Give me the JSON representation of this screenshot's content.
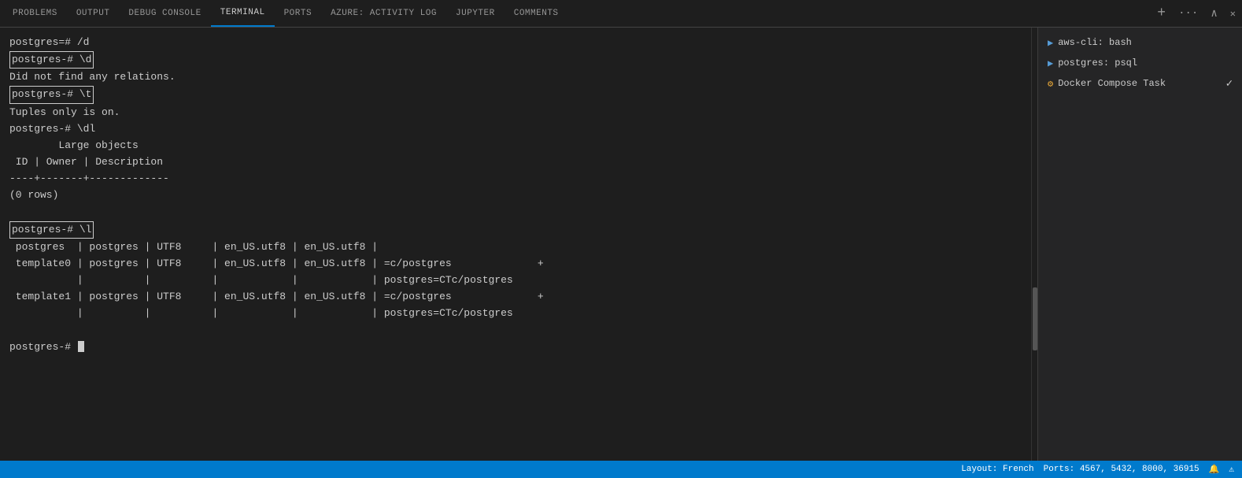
{
  "tabs": [
    {
      "id": "problems",
      "label": "PROBLEMS",
      "active": false
    },
    {
      "id": "output",
      "label": "OUTPUT",
      "active": false
    },
    {
      "id": "debug-console",
      "label": "DEBUG CONSOLE",
      "active": false
    },
    {
      "id": "terminal",
      "label": "TERMINAL",
      "active": true
    },
    {
      "id": "ports",
      "label": "PORTS",
      "active": false
    },
    {
      "id": "azure-activity-log",
      "label": "AZURE: ACTIVITY LOG",
      "active": false
    },
    {
      "id": "jupyter",
      "label": "JUPYTER",
      "active": false
    },
    {
      "id": "comments",
      "label": "COMMENTS",
      "active": false
    }
  ],
  "toolbar": {
    "add_label": "+",
    "more_label": "···",
    "chevron_up_label": "∧",
    "close_label": "✕"
  },
  "terminal": {
    "lines": [
      {
        "type": "normal",
        "text": "postgres=# /d"
      },
      {
        "type": "boxed",
        "text": "postgres-# \\d"
      },
      {
        "type": "normal",
        "text": "Did not find any relations."
      },
      {
        "type": "boxed",
        "text": "postgres-# \\t"
      },
      {
        "type": "normal",
        "text": "Tuples only is on."
      },
      {
        "type": "normal",
        "text": "postgres-# \\dl"
      },
      {
        "type": "normal",
        "text": "        Large objects"
      },
      {
        "type": "normal",
        "text": " ID | Owner | Description"
      },
      {
        "type": "normal",
        "text": "----+-------+-------------"
      },
      {
        "type": "normal",
        "text": "(0 rows)"
      },
      {
        "type": "blank",
        "text": ""
      },
      {
        "type": "boxed",
        "text": "postgres-# \\l"
      },
      {
        "type": "normal",
        "text": " postgres  | postgres | UTF8     | en_US.utf8 | en_US.utf8 |"
      },
      {
        "type": "normal",
        "text": " template0 | postgres | UTF8     | en_US.utf8 | en_US.utf8 | =c/postgres              +"
      },
      {
        "type": "normal",
        "text": "           |          |          |            |            | postgres=CTc/postgres"
      },
      {
        "type": "normal",
        "text": " template1 | postgres | UTF8     | en_US.utf8 | en_US.utf8 | =c/postgres              +"
      },
      {
        "type": "normal",
        "text": "           |          |          |            |            | postgres=CTc/postgres"
      },
      {
        "type": "blank",
        "text": ""
      },
      {
        "type": "prompt",
        "text": "postgres-# "
      }
    ]
  },
  "right_panel": {
    "items": [
      {
        "id": "aws-cli-bash",
        "label": "aws-cli: bash",
        "icon": "▶",
        "icon_type": "terminal",
        "checkmark": false
      },
      {
        "id": "postgres-psql",
        "label": "postgres: psql",
        "icon": "▶",
        "icon_type": "terminal",
        "checkmark": false
      },
      {
        "id": "docker-compose-task",
        "label": "Docker Compose  Task",
        "icon": "⚙",
        "icon_type": "task",
        "checkmark": true
      }
    ]
  },
  "status_bar": {
    "layout_label": "Layout: French",
    "ports_label": "Ports: 4567, 5432, 8000, 36915"
  }
}
